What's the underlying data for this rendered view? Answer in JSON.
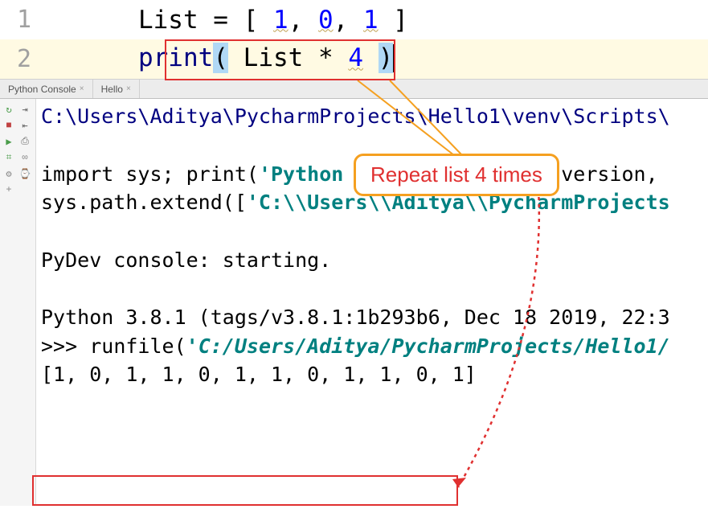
{
  "editor": {
    "lines": [
      {
        "num": "1",
        "code": {
          "var": "List",
          "eq": " = ",
          "lb": "[ ",
          "n1": "1",
          "c1": ", ",
          "n2": "0",
          "c2": ", ",
          "n3": "1",
          "rb": " ]"
        }
      },
      {
        "num": "2",
        "code": {
          "func": "print",
          "lp": "(",
          "sp1": " ",
          "var": "List",
          "op": " * ",
          "n": "4",
          "sp2": " ",
          "rp": ")"
        }
      }
    ]
  },
  "tabs": {
    "tab1": "Python Console",
    "tab2": "Hello"
  },
  "toolbar_icons": {
    "rerun": "↻",
    "stop": "■",
    "play": "▶",
    "bug": "⌗",
    "settings": "⚙",
    "plus": "+",
    "indent_inc": "⇥",
    "indent_dec": "⇤",
    "print": "⎙",
    "link": "∞",
    "history": "⌚"
  },
  "annotation": "Repeat list 4 times",
  "console": {
    "path": "C:\\Users\\Aditya\\PycharmProjects\\Hello1\\venv\\Scripts\\",
    "import_line": "import sys; print('Python %s on %s' % (sys.version, ",
    "extend_line": "sys.path.extend(['C:\\\\Users\\\\Aditya\\\\PycharmProjects",
    "pydev": "PyDev console: starting.",
    "python_ver": "Python 3.8.1 (tags/v3.8.1:1b293b6, Dec 18 2019, 22:3",
    "prompt": ">>> ",
    "runfile": "runfile(",
    "runfile_arg": "'C:/Users/Aditya/PycharmProjects/Hello1/",
    "output": "[1, 0, 1, 1, 0, 1, 1, 0, 1, 1, 0, 1]"
  }
}
